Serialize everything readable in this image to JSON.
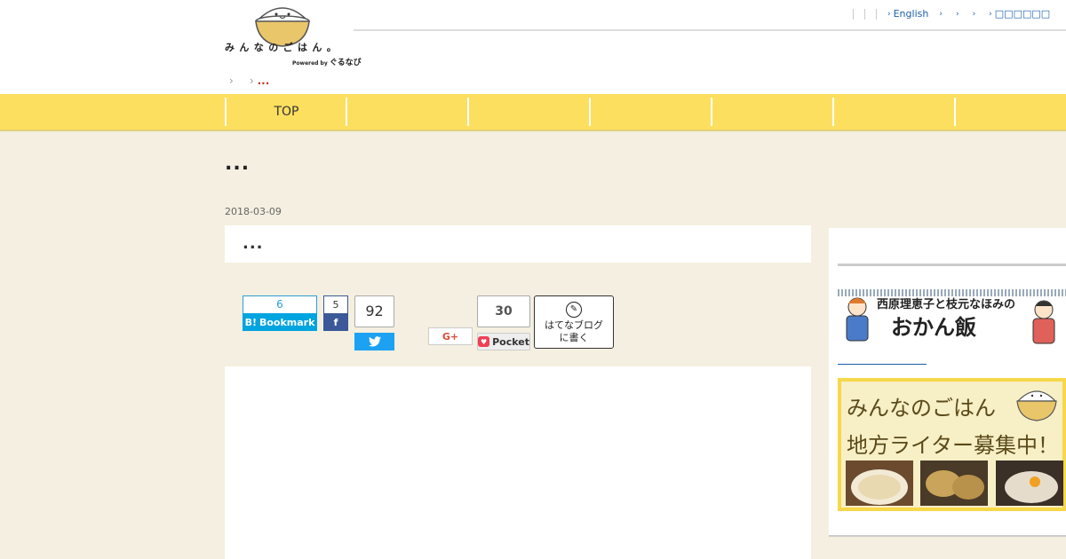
{
  "header": {
    "logo": {
      "title": "みんなのごはん。",
      "powered_by": "Powered by",
      "powered_brand": "ぐるなび"
    },
    "top_nav": [
      {
        "label": ""
      },
      {
        "label": ""
      },
      {
        "label": ""
      },
      {
        "label": "English"
      },
      {
        "label": ""
      },
      {
        "label": ""
      },
      {
        "label": ""
      },
      {
        "label": "□□□□□□"
      }
    ],
    "breadcrumb": {
      "current": "..."
    }
  },
  "global_nav": {
    "tabs": [
      {
        "label": "TOP"
      },
      {
        "label": ""
      },
      {
        "label": ""
      },
      {
        "label": ""
      },
      {
        "label": ""
      },
      {
        "label": ""
      },
      {
        "label": ""
      }
    ]
  },
  "article": {
    "title": "...",
    "date": "2018-03-09",
    "summary": "..."
  },
  "share": {
    "hatena_bookmark": {
      "count": "6",
      "label": "Bookmark",
      "icon": "B!"
    },
    "facebook": {
      "count": "5",
      "icon": "f"
    },
    "twitter": {
      "count": "92"
    },
    "google_plus": {
      "label": "G+"
    },
    "pocket": {
      "count": "30",
      "label": "Pocket"
    },
    "hatena_blog": {
      "line1": "はてなブログ",
      "line2": "に書く"
    }
  },
  "sidebar": {
    "okan_banner": {
      "line1": "西原理恵子と枝元なほみの",
      "line2": "おかん飯"
    },
    "writer_banner": {
      "line1": "みんなのごはん",
      "line2": "地方ライター募集中！"
    }
  },
  "colors": {
    "nav_yellow": "#fddf5f",
    "background": "#f4efe0",
    "hatena_blue": "#00a4de",
    "facebook_blue": "#3b5998",
    "twitter_blue": "#1da1f2",
    "pocket_red": "#ef3f56",
    "gplus_red": "#dd4b39"
  }
}
